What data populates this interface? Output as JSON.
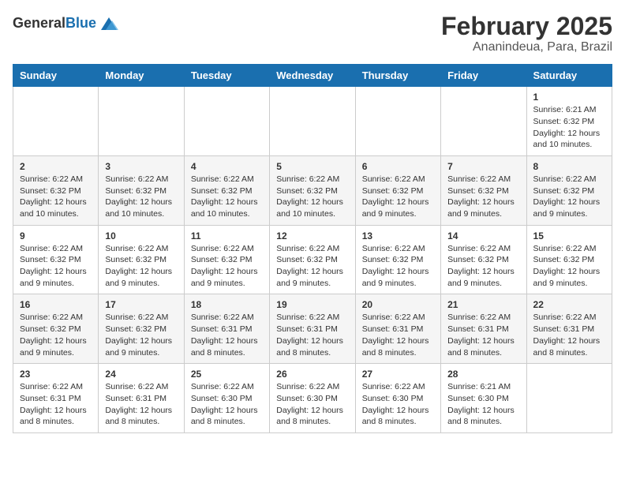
{
  "logo": {
    "general": "General",
    "blue": "Blue"
  },
  "title": "February 2025",
  "subtitle": "Ananindeua, Para, Brazil",
  "days_of_week": [
    "Sunday",
    "Monday",
    "Tuesday",
    "Wednesday",
    "Thursday",
    "Friday",
    "Saturday"
  ],
  "weeks": [
    [
      {
        "day": "",
        "info": ""
      },
      {
        "day": "",
        "info": ""
      },
      {
        "day": "",
        "info": ""
      },
      {
        "day": "",
        "info": ""
      },
      {
        "day": "",
        "info": ""
      },
      {
        "day": "",
        "info": ""
      },
      {
        "day": "1",
        "info": "Sunrise: 6:21 AM\nSunset: 6:32 PM\nDaylight: 12 hours\nand 10 minutes."
      }
    ],
    [
      {
        "day": "2",
        "info": "Sunrise: 6:22 AM\nSunset: 6:32 PM\nDaylight: 12 hours\nand 10 minutes."
      },
      {
        "day": "3",
        "info": "Sunrise: 6:22 AM\nSunset: 6:32 PM\nDaylight: 12 hours\nand 10 minutes."
      },
      {
        "day": "4",
        "info": "Sunrise: 6:22 AM\nSunset: 6:32 PM\nDaylight: 12 hours\nand 10 minutes."
      },
      {
        "day": "5",
        "info": "Sunrise: 6:22 AM\nSunset: 6:32 PM\nDaylight: 12 hours\nand 10 minutes."
      },
      {
        "day": "6",
        "info": "Sunrise: 6:22 AM\nSunset: 6:32 PM\nDaylight: 12 hours\nand 9 minutes."
      },
      {
        "day": "7",
        "info": "Sunrise: 6:22 AM\nSunset: 6:32 PM\nDaylight: 12 hours\nand 9 minutes."
      },
      {
        "day": "8",
        "info": "Sunrise: 6:22 AM\nSunset: 6:32 PM\nDaylight: 12 hours\nand 9 minutes."
      }
    ],
    [
      {
        "day": "9",
        "info": "Sunrise: 6:22 AM\nSunset: 6:32 PM\nDaylight: 12 hours\nand 9 minutes."
      },
      {
        "day": "10",
        "info": "Sunrise: 6:22 AM\nSunset: 6:32 PM\nDaylight: 12 hours\nand 9 minutes."
      },
      {
        "day": "11",
        "info": "Sunrise: 6:22 AM\nSunset: 6:32 PM\nDaylight: 12 hours\nand 9 minutes."
      },
      {
        "day": "12",
        "info": "Sunrise: 6:22 AM\nSunset: 6:32 PM\nDaylight: 12 hours\nand 9 minutes."
      },
      {
        "day": "13",
        "info": "Sunrise: 6:22 AM\nSunset: 6:32 PM\nDaylight: 12 hours\nand 9 minutes."
      },
      {
        "day": "14",
        "info": "Sunrise: 6:22 AM\nSunset: 6:32 PM\nDaylight: 12 hours\nand 9 minutes."
      },
      {
        "day": "15",
        "info": "Sunrise: 6:22 AM\nSunset: 6:32 PM\nDaylight: 12 hours\nand 9 minutes."
      }
    ],
    [
      {
        "day": "16",
        "info": "Sunrise: 6:22 AM\nSunset: 6:32 PM\nDaylight: 12 hours\nand 9 minutes."
      },
      {
        "day": "17",
        "info": "Sunrise: 6:22 AM\nSunset: 6:32 PM\nDaylight: 12 hours\nand 9 minutes."
      },
      {
        "day": "18",
        "info": "Sunrise: 6:22 AM\nSunset: 6:31 PM\nDaylight: 12 hours\nand 8 minutes."
      },
      {
        "day": "19",
        "info": "Sunrise: 6:22 AM\nSunset: 6:31 PM\nDaylight: 12 hours\nand 8 minutes."
      },
      {
        "day": "20",
        "info": "Sunrise: 6:22 AM\nSunset: 6:31 PM\nDaylight: 12 hours\nand 8 minutes."
      },
      {
        "day": "21",
        "info": "Sunrise: 6:22 AM\nSunset: 6:31 PM\nDaylight: 12 hours\nand 8 minutes."
      },
      {
        "day": "22",
        "info": "Sunrise: 6:22 AM\nSunset: 6:31 PM\nDaylight: 12 hours\nand 8 minutes."
      }
    ],
    [
      {
        "day": "23",
        "info": "Sunrise: 6:22 AM\nSunset: 6:31 PM\nDaylight: 12 hours\nand 8 minutes."
      },
      {
        "day": "24",
        "info": "Sunrise: 6:22 AM\nSunset: 6:31 PM\nDaylight: 12 hours\nand 8 minutes."
      },
      {
        "day": "25",
        "info": "Sunrise: 6:22 AM\nSunset: 6:30 PM\nDaylight: 12 hours\nand 8 minutes."
      },
      {
        "day": "26",
        "info": "Sunrise: 6:22 AM\nSunset: 6:30 PM\nDaylight: 12 hours\nand 8 minutes."
      },
      {
        "day": "27",
        "info": "Sunrise: 6:22 AM\nSunset: 6:30 PM\nDaylight: 12 hours\nand 8 minutes."
      },
      {
        "day": "28",
        "info": "Sunrise: 6:21 AM\nSunset: 6:30 PM\nDaylight: 12 hours\nand 8 minutes."
      },
      {
        "day": "",
        "info": ""
      }
    ]
  ]
}
